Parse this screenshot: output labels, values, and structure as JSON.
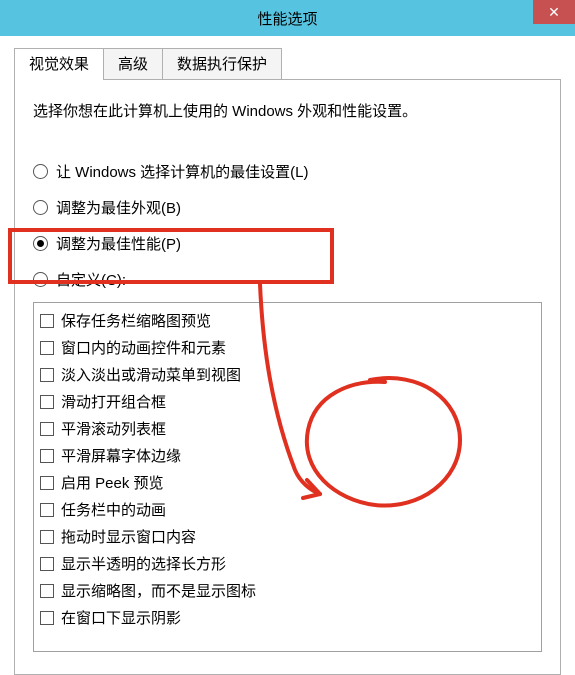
{
  "window": {
    "title": "性能选项",
    "close_glyph": "✕"
  },
  "tabs": [
    {
      "label": "视觉效果",
      "active": true
    },
    {
      "label": "高级",
      "active": false
    },
    {
      "label": "数据执行保护",
      "active": false
    }
  ],
  "description": "选择你想在此计算机上使用的 Windows 外观和性能设置。",
  "radios": [
    {
      "label": "让 Windows 选择计算机的最佳设置(L)",
      "checked": false
    },
    {
      "label": "调整为最佳外观(B)",
      "checked": false
    },
    {
      "label": "调整为最佳性能(P)",
      "checked": true
    },
    {
      "label": "自定义(C):",
      "checked": false
    }
  ],
  "checklist": [
    {
      "label": "保存任务栏缩略图预览",
      "checked": false
    },
    {
      "label": "窗口内的动画控件和元素",
      "checked": false
    },
    {
      "label": "淡入淡出或滑动菜单到视图",
      "checked": false
    },
    {
      "label": "滑动打开组合框",
      "checked": false
    },
    {
      "label": "平滑滚动列表框",
      "checked": false
    },
    {
      "label": "平滑屏幕字体边缘",
      "checked": false
    },
    {
      "label": "启用 Peek 预览",
      "checked": false
    },
    {
      "label": "任务栏中的动画",
      "checked": false
    },
    {
      "label": "拖动时显示窗口内容",
      "checked": false
    },
    {
      "label": "显示半透明的选择长方形",
      "checked": false
    },
    {
      "label": "显示缩略图，而不是显示图标",
      "checked": false
    },
    {
      "label": "在窗口下显示阴影",
      "checked": false
    }
  ],
  "annotation": {
    "highlight_color": "#e03020"
  }
}
